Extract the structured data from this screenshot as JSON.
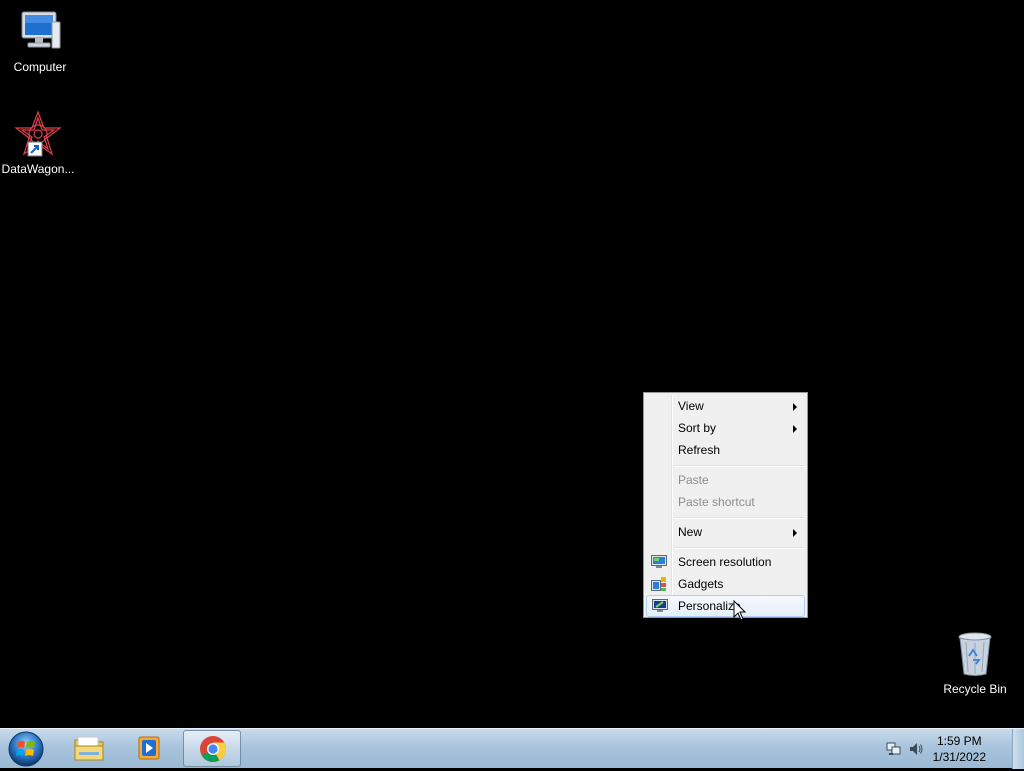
{
  "desktop": {
    "icons": [
      {
        "label": "Computer",
        "icon": "computer-icon"
      },
      {
        "label": "DataWagon...",
        "icon": "datawagon-shortcut-icon"
      },
      {
        "label": "Recycle Bin",
        "icon": "recycle-bin-icon"
      }
    ]
  },
  "context_menu": {
    "items": [
      {
        "label": "View",
        "submenu": true,
        "enabled": true
      },
      {
        "label": "Sort by",
        "submenu": true,
        "enabled": true
      },
      {
        "label": "Refresh",
        "submenu": false,
        "enabled": true
      },
      {
        "label": "Paste",
        "submenu": false,
        "enabled": false
      },
      {
        "label": "Paste shortcut",
        "submenu": false,
        "enabled": false
      },
      {
        "label": "New",
        "submenu": true,
        "enabled": true
      },
      {
        "label": "Screen resolution",
        "icon": "screen-resolution-icon",
        "enabled": true
      },
      {
        "label": "Gadgets",
        "icon": "gadgets-icon",
        "enabled": true
      },
      {
        "label": "Personalize",
        "icon": "personalize-icon",
        "enabled": true,
        "highlighted": true
      }
    ]
  },
  "taskbar": {
    "start": "windows-start-icon",
    "pinned": [
      {
        "name": "windows-explorer-icon"
      },
      {
        "name": "media-player-icon"
      },
      {
        "name": "chrome-icon",
        "active": true
      }
    ],
    "tray": {
      "network": "network-icon",
      "volume": "volume-icon",
      "time": "1:59 PM",
      "date": "1/31/2022"
    }
  }
}
